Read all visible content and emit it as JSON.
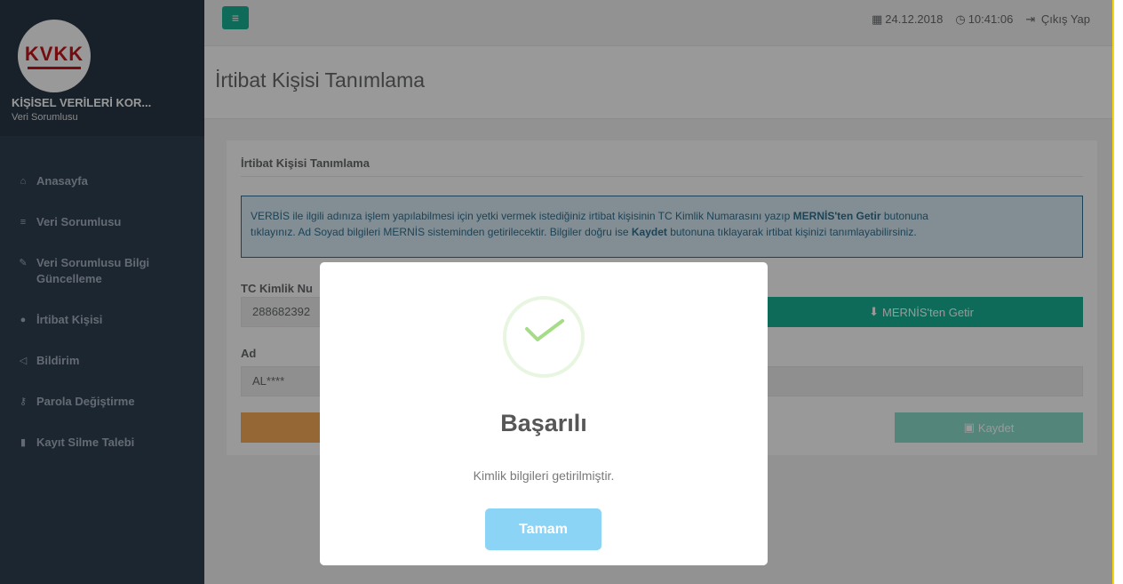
{
  "sidebar": {
    "logo_text": "KVKK",
    "org_name": "KİŞİSEL VERİLERİ KOR...",
    "org_role": "Veri Sorumlusu",
    "items": [
      {
        "icon": "home-icon",
        "glyph": "⌂",
        "label": "Anasayfa"
      },
      {
        "icon": "database-icon",
        "glyph": "≡",
        "label": "Veri Sorumlusu"
      },
      {
        "icon": "edit-icon",
        "glyph": "✎",
        "label": "Veri Sorumlusu Bilgi Güncelleme"
      },
      {
        "icon": "user-icon",
        "glyph": "●",
        "label": "İrtibat Kişisi"
      },
      {
        "icon": "bullhorn-icon",
        "glyph": "◁",
        "label": "Bildirim"
      },
      {
        "icon": "key-icon",
        "glyph": "⚷",
        "label": "Parola Değiştirme"
      },
      {
        "icon": "trash-icon",
        "glyph": "▮",
        "label": "Kayıt Silme Talebi"
      }
    ]
  },
  "topbar": {
    "menu_glyph": "≡",
    "date": "24.12.2018",
    "time": "10:41:06",
    "logout": "Çıkış Yap"
  },
  "page": {
    "title": "İrtibat Kişisi Tanımlama",
    "panel_title": "İrtibat Kişisi Tanımlama",
    "alert_line1_a": "VERBİS ile ilgili adınıza işlem yapılabilmesi için yetki vermek istediğiniz irtibat kişisinin TC Kimlik Numarasını yazıp ",
    "alert_line1_b": "MERNİS'ten Getir",
    "alert_line1_c": " butonuna",
    "alert_line2_a": "tıklayınız. Ad Soyad bilgileri MERNİS sisteminden getirilecektir. Bilgiler doğru ise ",
    "alert_line2_b": "Kaydet",
    "alert_line2_c": " butonuna tıklayarak irtibat kişinizi tanımlayabilirsiniz.",
    "tc_label": "TC Kimlik Nu",
    "tc_value": "288682392",
    "mernis_button": "MERNİS'ten Getir",
    "ad_label": "Ad",
    "ad_value": "AL****",
    "save_button": "Kaydet"
  },
  "modal": {
    "title": "Başarılı",
    "message": "Kimlik bilgileri getirilmiştir.",
    "ok_button": "Tamam"
  }
}
